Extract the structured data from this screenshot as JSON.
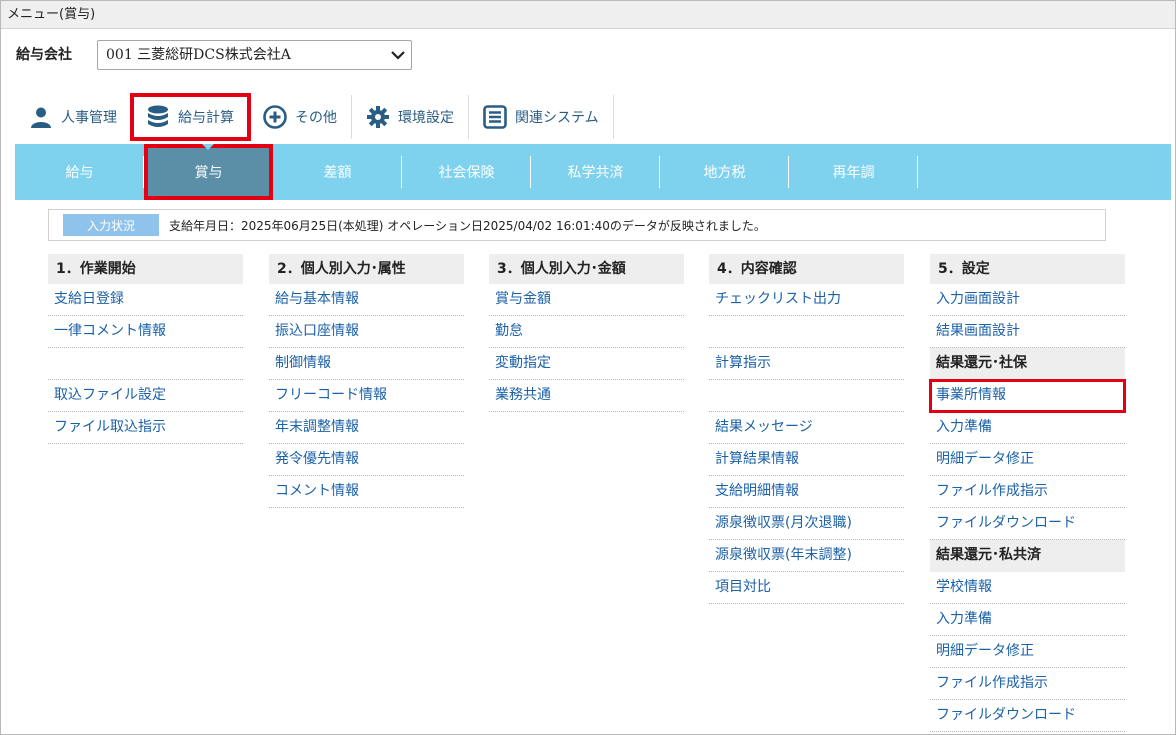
{
  "window": {
    "title": "メニュー(賞与)"
  },
  "company": {
    "label": "給与会社",
    "selected": "001 三菱総研DCS株式会社A"
  },
  "top_nav": [
    {
      "label": "人事管理",
      "icon": "person-icon",
      "color": "#2a5d84"
    },
    {
      "label": "給与計算",
      "icon": "database-icon",
      "color": "#2a5d84"
    },
    {
      "label": "その他",
      "icon": "plus-circle-icon",
      "color": "#2a5d84"
    },
    {
      "label": "環境設定",
      "icon": "gear-icon",
      "color": "#2a5d84"
    },
    {
      "label": "関連システム",
      "icon": "list-icon",
      "color": "#2a5d84"
    }
  ],
  "sub_nav": [
    "給与",
    "賞与",
    "差額",
    "社会保険",
    "私学共済",
    "地方税",
    "再年調"
  ],
  "status": {
    "badge": "入力状況",
    "message": "支給年月日：2025年06月25日(本処理) オペレーション日2025/04/02 16:01:40のデータが反映されました。"
  },
  "columns": [
    {
      "title": "1．作業開始",
      "items": [
        "支給日登録",
        "一律コメント情報",
        "",
        "取込ファイル設定",
        "ファイル取込指示"
      ]
    },
    {
      "title": "2．個人別入力･属性",
      "items": [
        "給与基本情報",
        "振込口座情報",
        "制御情報",
        "フリーコード情報",
        "年末調整情報",
        "発令優先情報",
        "コメント情報"
      ]
    },
    {
      "title": "3．個人別入力･金額",
      "items": [
        "賞与金額",
        "勤怠",
        "変動指定",
        "業務共通"
      ]
    },
    {
      "title": "4．内容確認",
      "items": [
        "チェックリスト出力",
        "",
        "計算指示",
        "",
        "結果メッセージ",
        "計算結果情報",
        "支給明細情報",
        "源泉徴収票(月次退職)",
        "源泉徴収票(年末調整)",
        "項目対比"
      ]
    },
    {
      "title": "5．設定",
      "items": [
        "入力画面設計",
        "結果画面設計",
        "結果還元･社保",
        "事業所情報",
        "入力準備",
        "明細データ修正",
        "ファイル作成指示",
        "ファイルダウンロード",
        "結果還元･私共済",
        "学校情報",
        "入力準備",
        "明細データ修正",
        "ファイル作成指示",
        "ファイルダウンロード"
      ]
    }
  ],
  "colors": {
    "accent_blue": "#7ed2ee",
    "active_tab": "#5b8fa7",
    "highlight_red": "#e30012",
    "link": "#1b61a8"
  }
}
